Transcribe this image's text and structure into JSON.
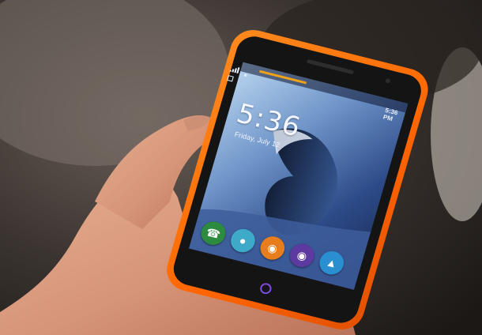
{
  "lockscreen": {
    "time": "5:36",
    "date": "Friday, July 12",
    "status_time": "5:36 PM"
  },
  "dock": {
    "apps": [
      {
        "name": "phone",
        "icon": "phone-icon",
        "color": "#2c8b3e"
      },
      {
        "name": "messages",
        "icon": "message-bubble-icon",
        "color": "#3fa9c9"
      },
      {
        "name": "browser",
        "icon": "firefox-icon",
        "color": "#e77d1c"
      },
      {
        "name": "camera",
        "icon": "camera-icon",
        "color": "#5d3aa0"
      },
      {
        "name": "marketplace",
        "icon": "marketplace-icon",
        "color": "#2a8fd0"
      }
    ]
  },
  "colors": {
    "phone_body": "#ff6a00",
    "skin": "#d89a7e",
    "background": "#2a2624",
    "wallpaper_wave": "#2f4f8f"
  }
}
